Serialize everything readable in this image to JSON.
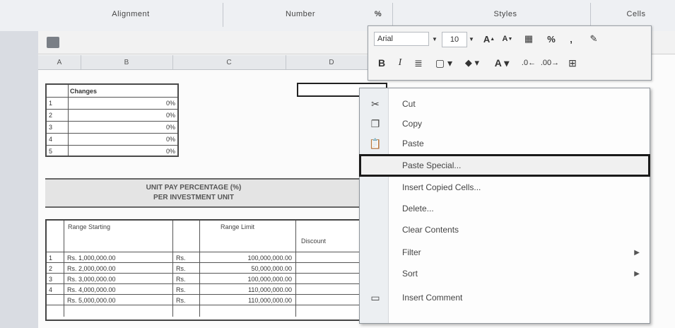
{
  "ribbon": {
    "groups": [
      "Alignment",
      "Number",
      "Styles",
      "Cells"
    ],
    "percent_symbol": "%"
  },
  "mini_toolbar": {
    "font_name": "Arial",
    "font_size": "10",
    "row1_icons": [
      "grow-font-icon",
      "shrink-font-icon",
      "currency-icon",
      "percent-icon",
      "comma-icon",
      "format-painter-icon"
    ],
    "row2_icons": [
      "bold-icon",
      "italic-icon",
      "align-center-icon",
      "borders-icon",
      "fill-color-icon",
      "font-color-icon",
      "decrease-decimal-icon",
      "increase-decimal-icon",
      "merge-icon"
    ]
  },
  "context_menu": {
    "items": [
      {
        "label": "Cut",
        "icon": "scissors-icon"
      },
      {
        "label": "Copy",
        "icon": "copy-icon"
      },
      {
        "label": "Paste",
        "icon": "paste-icon"
      },
      {
        "label": "Paste Special...",
        "icon": "",
        "highlighted": true
      },
      {
        "label": "Insert Copied Cells...",
        "icon": ""
      },
      {
        "label": "Delete...",
        "icon": ""
      },
      {
        "label": "Clear Contents",
        "icon": ""
      },
      {
        "label": "Filter",
        "icon": "",
        "submenu": true
      },
      {
        "label": "Sort",
        "icon": "",
        "submenu": true
      },
      {
        "label": "Insert Comment",
        "icon": "comment-icon"
      }
    ],
    "submenu_arrow": "▶"
  },
  "sheet": {
    "col_headers": [
      "A",
      "B",
      "C",
      "D"
    ],
    "top_table": {
      "header": "Changes",
      "rows": [
        {
          "n": "1",
          "pct": "0%"
        },
        {
          "n": "2",
          "pct": "0%"
        },
        {
          "n": "3",
          "pct": "0%"
        },
        {
          "n": "4",
          "pct": "0%"
        },
        {
          "n": "5",
          "pct": "0%"
        }
      ]
    },
    "title_band": {
      "line1": "UNIT PAY PERCENTAGE (%)",
      "line2": "PER INVESTMENT UNIT"
    },
    "data_table": {
      "headers": [
        "Range Starting",
        "Range Limit",
        "Discount"
      ],
      "rows": [
        {
          "id": "1",
          "start": "Rs. 1,000,000.00",
          "prefix": "Rs.",
          "limit": "100,000,000.00"
        },
        {
          "id": "2",
          "start": "Rs. 2,000,000.00",
          "prefix": "Rs.",
          "limit": "50,000,000.00"
        },
        {
          "id": "3",
          "start": "Rs. 3,000,000.00",
          "prefix": "Rs.",
          "limit": "100,000,000.00"
        },
        {
          "id": "4",
          "start": "Rs. 4,000,000.00",
          "prefix": "Rs.",
          "limit": "110,000,000.00"
        },
        {
          "id": "",
          "start": "Rs. 5,000,000.00",
          "prefix": "Rs.",
          "limit": "110,000,000.00"
        }
      ]
    }
  }
}
